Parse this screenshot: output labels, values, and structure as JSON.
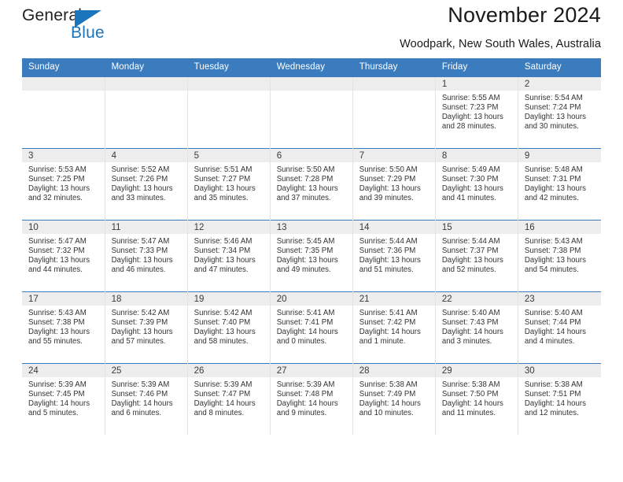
{
  "logo": {
    "word_one": "General",
    "word_two": "Blue",
    "triangle_icon": "triangle-icon",
    "brand_color": "#1b75bc"
  },
  "header": {
    "title": "November 2024",
    "subtitle": "Woodpark, New South Wales, Australia"
  },
  "theme": {
    "header_blue": "#3b7cbe",
    "daynum_band": "#ededed",
    "text": "#333333"
  },
  "weekdays": [
    "Sunday",
    "Monday",
    "Tuesday",
    "Wednesday",
    "Thursday",
    "Friday",
    "Saturday"
  ],
  "labels": {
    "sunrise_prefix": "Sunrise:",
    "sunset_prefix": "Sunset:",
    "daylight_prefix": "Daylight:"
  },
  "weeks": [
    [
      {
        "day": "",
        "empty": true
      },
      {
        "day": "",
        "empty": true
      },
      {
        "day": "",
        "empty": true
      },
      {
        "day": "",
        "empty": true
      },
      {
        "day": "",
        "empty": true
      },
      {
        "day": "1",
        "sunrise": "Sunrise: 5:55 AM",
        "sunset": "Sunset: 7:23 PM",
        "daylight": "Daylight: 13 hours and 28 minutes."
      },
      {
        "day": "2",
        "sunrise": "Sunrise: 5:54 AM",
        "sunset": "Sunset: 7:24 PM",
        "daylight": "Daylight: 13 hours and 30 minutes."
      }
    ],
    [
      {
        "day": "3",
        "sunrise": "Sunrise: 5:53 AM",
        "sunset": "Sunset: 7:25 PM",
        "daylight": "Daylight: 13 hours and 32 minutes."
      },
      {
        "day": "4",
        "sunrise": "Sunrise: 5:52 AM",
        "sunset": "Sunset: 7:26 PM",
        "daylight": "Daylight: 13 hours and 33 minutes."
      },
      {
        "day": "5",
        "sunrise": "Sunrise: 5:51 AM",
        "sunset": "Sunset: 7:27 PM",
        "daylight": "Daylight: 13 hours and 35 minutes."
      },
      {
        "day": "6",
        "sunrise": "Sunrise: 5:50 AM",
        "sunset": "Sunset: 7:28 PM",
        "daylight": "Daylight: 13 hours and 37 minutes."
      },
      {
        "day": "7",
        "sunrise": "Sunrise: 5:50 AM",
        "sunset": "Sunset: 7:29 PM",
        "daylight": "Daylight: 13 hours and 39 minutes."
      },
      {
        "day": "8",
        "sunrise": "Sunrise: 5:49 AM",
        "sunset": "Sunset: 7:30 PM",
        "daylight": "Daylight: 13 hours and 41 minutes."
      },
      {
        "day": "9",
        "sunrise": "Sunrise: 5:48 AM",
        "sunset": "Sunset: 7:31 PM",
        "daylight": "Daylight: 13 hours and 42 minutes."
      }
    ],
    [
      {
        "day": "10",
        "sunrise": "Sunrise: 5:47 AM",
        "sunset": "Sunset: 7:32 PM",
        "daylight": "Daylight: 13 hours and 44 minutes."
      },
      {
        "day": "11",
        "sunrise": "Sunrise: 5:47 AM",
        "sunset": "Sunset: 7:33 PM",
        "daylight": "Daylight: 13 hours and 46 minutes."
      },
      {
        "day": "12",
        "sunrise": "Sunrise: 5:46 AM",
        "sunset": "Sunset: 7:34 PM",
        "daylight": "Daylight: 13 hours and 47 minutes."
      },
      {
        "day": "13",
        "sunrise": "Sunrise: 5:45 AM",
        "sunset": "Sunset: 7:35 PM",
        "daylight": "Daylight: 13 hours and 49 minutes."
      },
      {
        "day": "14",
        "sunrise": "Sunrise: 5:44 AM",
        "sunset": "Sunset: 7:36 PM",
        "daylight": "Daylight: 13 hours and 51 minutes."
      },
      {
        "day": "15",
        "sunrise": "Sunrise: 5:44 AM",
        "sunset": "Sunset: 7:37 PM",
        "daylight": "Daylight: 13 hours and 52 minutes."
      },
      {
        "day": "16",
        "sunrise": "Sunrise: 5:43 AM",
        "sunset": "Sunset: 7:38 PM",
        "daylight": "Daylight: 13 hours and 54 minutes."
      }
    ],
    [
      {
        "day": "17",
        "sunrise": "Sunrise: 5:43 AM",
        "sunset": "Sunset: 7:38 PM",
        "daylight": "Daylight: 13 hours and 55 minutes."
      },
      {
        "day": "18",
        "sunrise": "Sunrise: 5:42 AM",
        "sunset": "Sunset: 7:39 PM",
        "daylight": "Daylight: 13 hours and 57 minutes."
      },
      {
        "day": "19",
        "sunrise": "Sunrise: 5:42 AM",
        "sunset": "Sunset: 7:40 PM",
        "daylight": "Daylight: 13 hours and 58 minutes."
      },
      {
        "day": "20",
        "sunrise": "Sunrise: 5:41 AM",
        "sunset": "Sunset: 7:41 PM",
        "daylight": "Daylight: 14 hours and 0 minutes."
      },
      {
        "day": "21",
        "sunrise": "Sunrise: 5:41 AM",
        "sunset": "Sunset: 7:42 PM",
        "daylight": "Daylight: 14 hours and 1 minute."
      },
      {
        "day": "22",
        "sunrise": "Sunrise: 5:40 AM",
        "sunset": "Sunset: 7:43 PM",
        "daylight": "Daylight: 14 hours and 3 minutes."
      },
      {
        "day": "23",
        "sunrise": "Sunrise: 5:40 AM",
        "sunset": "Sunset: 7:44 PM",
        "daylight": "Daylight: 14 hours and 4 minutes."
      }
    ],
    [
      {
        "day": "24",
        "sunrise": "Sunrise: 5:39 AM",
        "sunset": "Sunset: 7:45 PM",
        "daylight": "Daylight: 14 hours and 5 minutes."
      },
      {
        "day": "25",
        "sunrise": "Sunrise: 5:39 AM",
        "sunset": "Sunset: 7:46 PM",
        "daylight": "Daylight: 14 hours and 6 minutes."
      },
      {
        "day": "26",
        "sunrise": "Sunrise: 5:39 AM",
        "sunset": "Sunset: 7:47 PM",
        "daylight": "Daylight: 14 hours and 8 minutes."
      },
      {
        "day": "27",
        "sunrise": "Sunrise: 5:39 AM",
        "sunset": "Sunset: 7:48 PM",
        "daylight": "Daylight: 14 hours and 9 minutes."
      },
      {
        "day": "28",
        "sunrise": "Sunrise: 5:38 AM",
        "sunset": "Sunset: 7:49 PM",
        "daylight": "Daylight: 14 hours and 10 minutes."
      },
      {
        "day": "29",
        "sunrise": "Sunrise: 5:38 AM",
        "sunset": "Sunset: 7:50 PM",
        "daylight": "Daylight: 14 hours and 11 minutes."
      },
      {
        "day": "30",
        "sunrise": "Sunrise: 5:38 AM",
        "sunset": "Sunset: 7:51 PM",
        "daylight": "Daylight: 14 hours and 12 minutes."
      }
    ]
  ]
}
